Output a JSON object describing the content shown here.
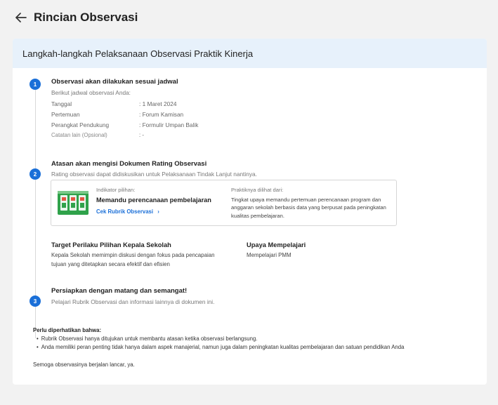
{
  "header": {
    "title": "Rincian Observasi"
  },
  "card": {
    "heading": "Langkah-langkah Pelaksanaan Observasi Praktik Kinerja"
  },
  "steps": [
    {
      "number": "1",
      "title": "Observasi akan dilakukan sesuai jadwal",
      "subtitle": "Berikut jadwal observasi Anda:",
      "details": [
        {
          "label": "Tanggal",
          "value": ": 1 Maret 2024"
        },
        {
          "label": "Pertemuan",
          "value": ": Forum Kamisan"
        },
        {
          "label": "Perangkat Pendukung",
          "value": ": Formulir Umpan Balik"
        },
        {
          "label": "Catatan lain (Opsional)",
          "value": ": -"
        }
      ]
    },
    {
      "number": "2",
      "title": "Atasan akan mengisi Dokumen Rating Observasi",
      "subtitle": "Rating observasi dapat didiskusikan untuk Pelaksanaan Tindak Lanjut nantinya."
    },
    {
      "number": "3",
      "title": "Persiapkan dengan matang dan semangat!",
      "subtitle": "Pelajari Rubrik Observasi dan informasi lainnya di dokumen ini."
    }
  ],
  "indicator": {
    "label": "Indikator pilihan:",
    "name": "Memandu perencanaan pembelajaran",
    "link": "Cek Rubrik Observasi",
    "link_arrow": "›",
    "practice_label": "Praktiknya dilihat dari:",
    "practice_text": "Tingkat upaya memandu pertemuan perencanaan program dan anggaran sekolah berbasis data yang berpusat pada peningkatan kualitas pembelajaran."
  },
  "target": {
    "title": "Target Perilaku Pilihan Kepala Sekolah",
    "text": "Kepala Sekolah memimpin diskusi dengan fokus pada pencapaian tujuan yang ditetapkan secara efektif dan efisien"
  },
  "effort": {
    "title": "Upaya Mempelajari",
    "text": "Mempelajari PMM"
  },
  "notes": {
    "title": "Perlu diperhatikan bahwa:",
    "items": [
      "Rubrik Observasi hanya ditujukan untuk membantu atasan ketika observasi berlangsung.",
      "Anda memiliki peran penting tidak hanya dalam aspek manajerial, namun juga dalam peningkatan kualitas pembelajaran dan satuan pendidikan Anda"
    ]
  },
  "closing": "Semoga observasinya berjalan lancar, ya.",
  "colors": {
    "accent": "#1a6fd8",
    "header_bg": "#e7f1fb",
    "page_bg": "#f2f2f2"
  },
  "icons": {
    "back": "arrow-left-icon",
    "thumbnail": "indicator-thumbnail"
  }
}
